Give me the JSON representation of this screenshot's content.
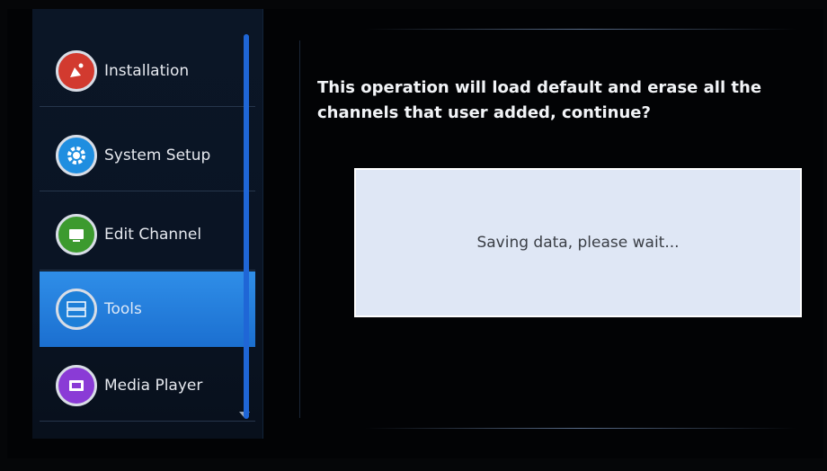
{
  "menu": {
    "items": [
      {
        "label": "Installation",
        "icon": "satellite-dish-icon",
        "color": "#d23a2f"
      },
      {
        "label": "System Setup",
        "icon": "gear-icon",
        "color": "#1f8ee0"
      },
      {
        "label": "Edit Channel",
        "icon": "edit-channel-icon",
        "color": "#3c9a2e"
      },
      {
        "label": "Tools",
        "icon": "tools-icon",
        "color": "#1d7fd8",
        "active": true
      },
      {
        "label": "Media Player",
        "icon": "media-player-icon",
        "color": "#8a3bd6"
      }
    ]
  },
  "dialog": {
    "message": "This operation will load default and erase all the channels that user added, continue?",
    "status": "Saving data, please wait..."
  }
}
